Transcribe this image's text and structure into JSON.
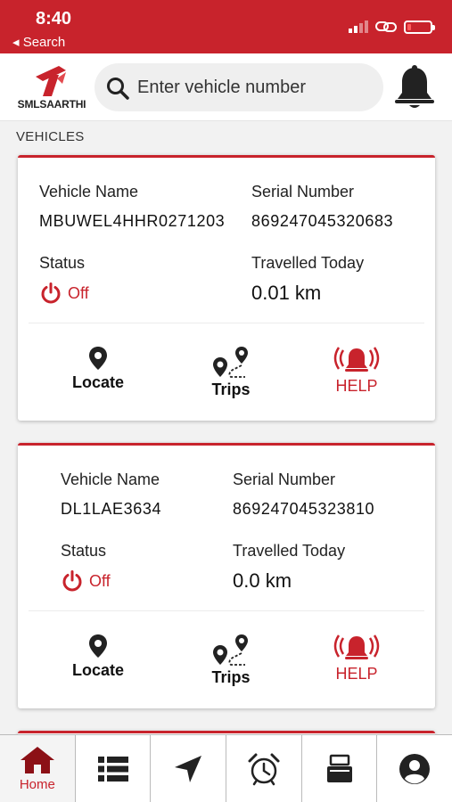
{
  "status_bar": {
    "time": "8:40",
    "back_label": "◂ Search"
  },
  "header": {
    "logo_text": "SMLSAARTHI",
    "search_placeholder": "Enter vehicle number"
  },
  "section_title": "VEHICLES",
  "labels": {
    "vehicle_name": "Vehicle Name",
    "serial_number": "Serial Number",
    "status": "Status",
    "travelled_today": "Travelled Today"
  },
  "vehicles": [
    {
      "name": "MBUWEL4HHR0271203",
      "serial": "869247045320683",
      "status": "Off",
      "travelled": "0.01 km"
    },
    {
      "name": "DL1LAE3634",
      "serial": "869247045323810",
      "status": "Off",
      "travelled": "0.0 km"
    }
  ],
  "actions": {
    "locate": "Locate",
    "trips": "Trips",
    "help": "HELP"
  },
  "nav": {
    "home": "Home"
  },
  "colors": {
    "brand": "#c8232c",
    "text": "#111111",
    "background": "#f2f2f2"
  }
}
